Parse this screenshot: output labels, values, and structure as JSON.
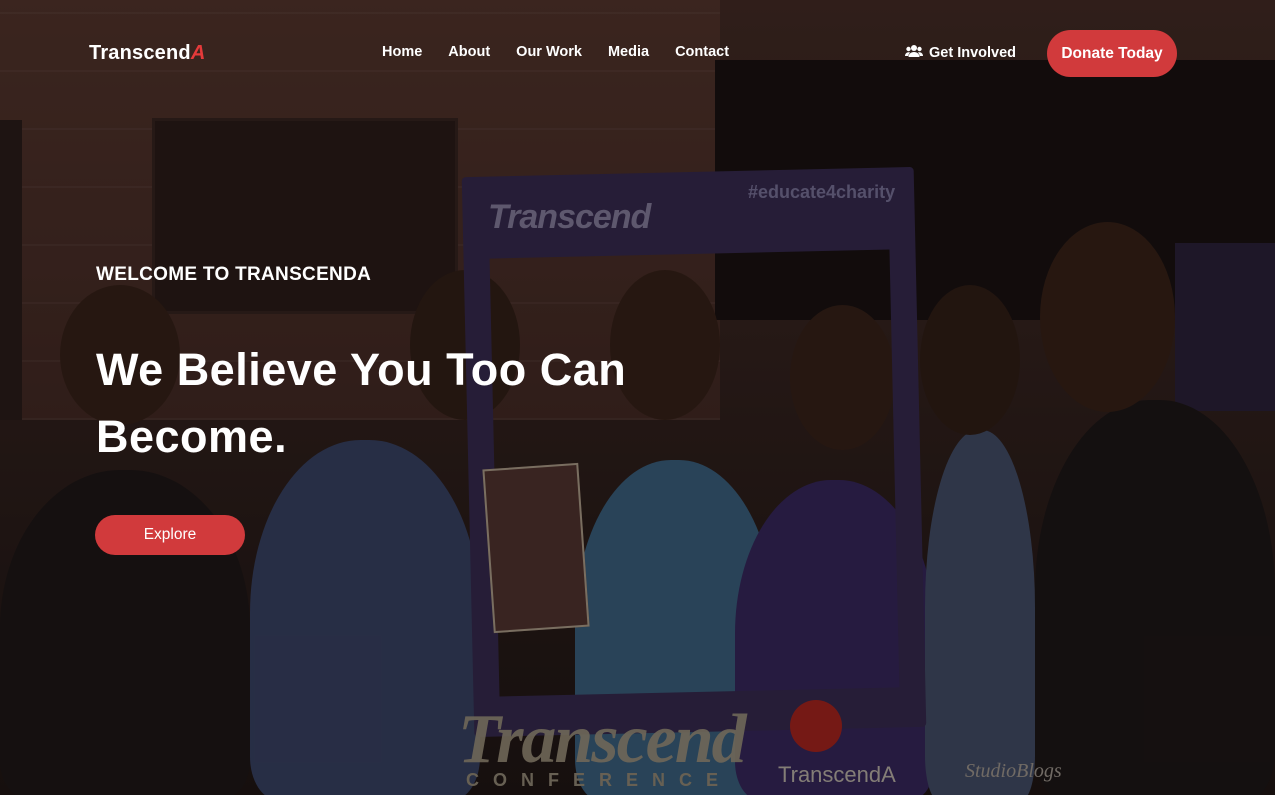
{
  "header": {
    "logo_main": "Transcend",
    "logo_accent": "A",
    "nav": [
      {
        "label": "Home"
      },
      {
        "label": "About"
      },
      {
        "label": "Our Work"
      },
      {
        "label": "Media"
      },
      {
        "label": "Contact"
      }
    ],
    "get_involved": {
      "label": "Get Involved",
      "icon": "users-icon"
    },
    "donate_label": "Donate Today"
  },
  "hero": {
    "eyebrow": "WELCOME TO TRANSCENDA",
    "headline": "We Believe You Too Can Become.",
    "cta_label": "Explore",
    "background_texts": {
      "frame_left": "Transcend",
      "frame_right": "#educate4charity",
      "bottom_logo": "Transcend",
      "bottom_logo_sub": "CONFERENCE",
      "brand_mark": "TranscendA"
    }
  },
  "colors": {
    "accent": "#d13a3c",
    "logo_accent": "#e43a3a",
    "text": "#ffffff"
  }
}
